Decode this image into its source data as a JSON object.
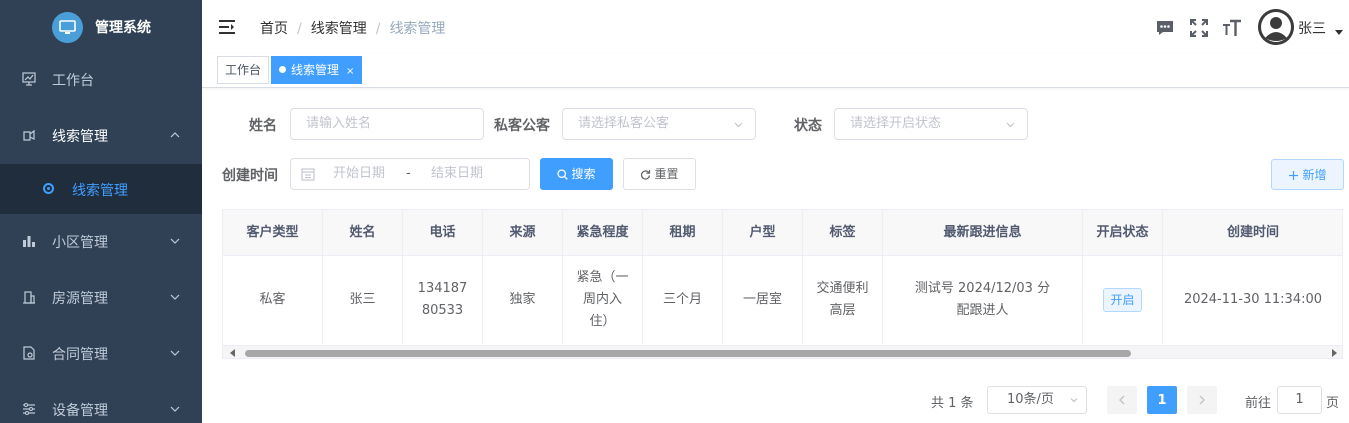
{
  "sidebar": {
    "title": "管理系统",
    "items": [
      {
        "label": "工作台",
        "icon": "dashboard-icon"
      },
      {
        "label": "线索管理",
        "icon": "clue-icon",
        "expanded": true
      },
      {
        "label": "小区管理",
        "icon": "chart-icon"
      },
      {
        "label": "房源管理",
        "icon": "building-icon"
      },
      {
        "label": "合同管理",
        "icon": "contract-icon"
      },
      {
        "label": "设备管理",
        "icon": "device-icon"
      }
    ],
    "active_sub": "线索管理"
  },
  "header": {
    "breadcrumb": [
      "首页",
      "线索管理",
      "线索管理"
    ],
    "username": "张三"
  },
  "tags": [
    {
      "label": "工作台"
    },
    {
      "label": "线索管理",
      "close": "×"
    }
  ],
  "form": {
    "name_label": "姓名",
    "name_placeholder": "请输入姓名",
    "private_label": "私客公客",
    "private_placeholder": "请选择私客公客",
    "status_label": "状态",
    "status_placeholder": "请选择开启状态",
    "created_label": "创建时间",
    "start_placeholder": "开始日期",
    "range_sep": "-",
    "end_placeholder": "结束日期",
    "search_btn": "搜索",
    "reset_btn": "重置",
    "add_btn": "新增"
  },
  "table": {
    "columns": [
      "客户类型",
      "姓名",
      "电话",
      "来源",
      "紧急程度",
      "租期",
      "户型",
      "标签",
      "最新跟进信息",
      "开启状态",
      "创建时间"
    ],
    "rows": [
      {
        "type": "私客",
        "name": "张三",
        "phone": "13418780533",
        "source": "独家",
        "urgency": "紧急（一周内入住）",
        "lease": "三个月",
        "layout": "一居室",
        "tags": "交通便利 高层",
        "followup": "测试号 2024/12/03 分配跟进人",
        "status": "开启",
        "created": "2024-11-30 11:34:00"
      }
    ]
  },
  "pagination": {
    "total": "共 1 条",
    "page_size": "10条/页",
    "current": "1",
    "goto_prefix": "前往",
    "goto_value": "1",
    "goto_suffix": "页"
  },
  "colors": {
    "sidebar_bg": "#304156",
    "sidebar_active_bg": "#1f2d3d",
    "primary": "#409eff"
  }
}
